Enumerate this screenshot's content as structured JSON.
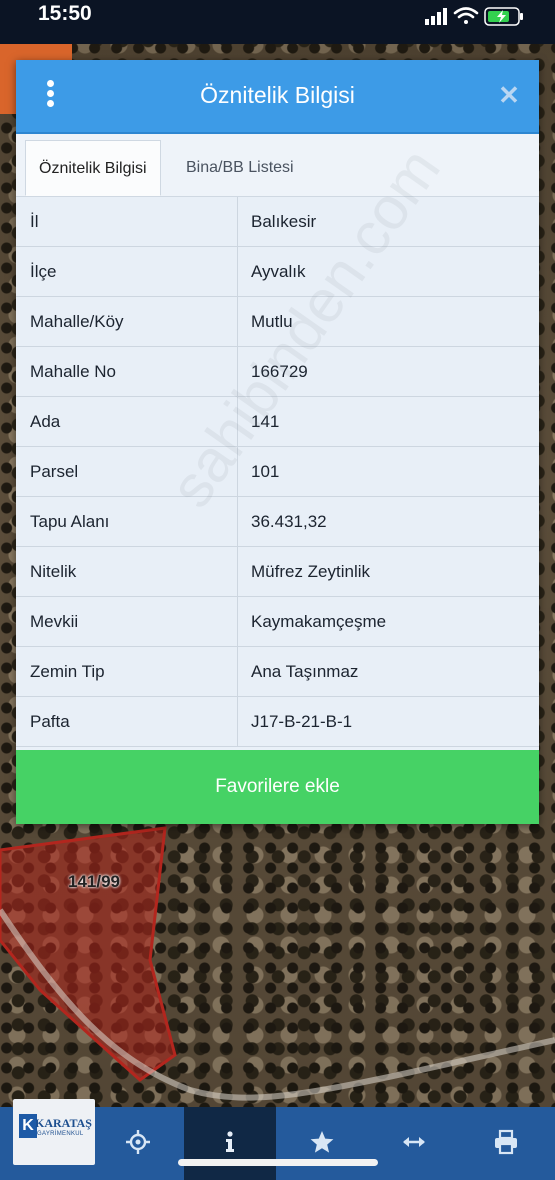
{
  "status_bar": {
    "time": "15:50"
  },
  "dialog": {
    "title": "Öznitelik Bilgisi",
    "tabs": [
      {
        "label": "Öznitelik Bilgisi",
        "active": true
      },
      {
        "label": "Bina/BB Listesi",
        "active": false
      }
    ],
    "rows": [
      {
        "label": "İl",
        "value": "Balıkesir"
      },
      {
        "label": "İlçe",
        "value": "Ayvalık"
      },
      {
        "label": "Mahalle/Köy",
        "value": "Mutlu"
      },
      {
        "label": "Mahalle No",
        "value": "166729"
      },
      {
        "label": "Ada",
        "value": "141"
      },
      {
        "label": "Parsel",
        "value": "101"
      },
      {
        "label": "Tapu Alanı",
        "value": "36.431,32"
      },
      {
        "label": "Nitelik",
        "value": "Müfrez Zeytinlik"
      },
      {
        "label": "Mevkii",
        "value": "Kaymakamçeşme"
      },
      {
        "label": "Zemin Tip",
        "value": "Ana Taşınmaz"
      },
      {
        "label": "Pafta",
        "value": "J17-B-21-B-1"
      }
    ],
    "favorite_button": "Favorilere ekle",
    "watermark": "sahibinden.com"
  },
  "map": {
    "parcel_label": "141/99"
  },
  "toolbar": {
    "items": [
      {
        "icon": "location-target-icon"
      },
      {
        "icon": "info-icon",
        "active": true
      },
      {
        "icon": "star-icon"
      },
      {
        "icon": "measure-arrows-icon"
      },
      {
        "icon": "print-icon"
      }
    ]
  },
  "logo": {
    "text": "KARATAŞ",
    "subtext": "GAYRİMENKUL",
    "letter": "K"
  },
  "colors": {
    "header_blue": "#3d9be7",
    "favorite_green": "#46d265",
    "toolbar_blue": "#245a9c",
    "parcel_red": "#b3261e"
  }
}
